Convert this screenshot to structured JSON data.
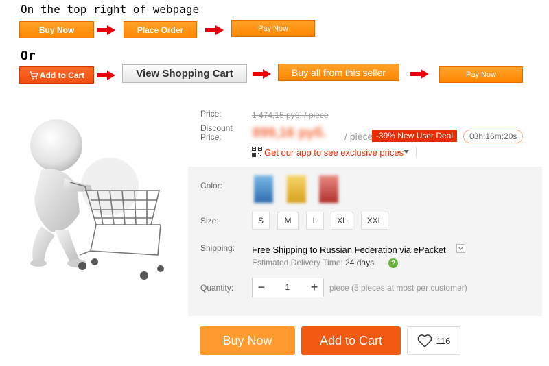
{
  "guide": {
    "caption_top": "On the top right of webpage",
    "caption_or": "Or",
    "row1": [
      "Buy Now",
      "Place Order",
      "Pay Now"
    ],
    "row2": [
      "Add to Cart",
      "View Shopping Cart",
      "Buy all from this seller",
      "Pay Now"
    ]
  },
  "product": {
    "price_label": "Price:",
    "old_price": "1 474,15 руб. / piece",
    "discount_label": "Discount Price:",
    "discount_price": "899,16 руб.",
    "per_piece": "/ piece",
    "deal_badge": "-39% New User Deal",
    "timer": "03h:16m:20s",
    "app_prompt": "Get our app to see exclusive prices",
    "color_label": "Color:",
    "size_label": "Size:",
    "sizes": [
      "S",
      "M",
      "L",
      "XL",
      "XXL"
    ],
    "shipping_label": "Shipping:",
    "shipping_free": "Free Shipping",
    "shipping_to": "to",
    "shipping_country": "Russian Federation via ePacket",
    "delivery_label": "Estimated Delivery Time:",
    "delivery_value": "24 days",
    "quantity_label": "Quantity:",
    "quantity_value": "1",
    "quantity_note": "piece (5 pieces at most per customer)",
    "buy_now": "Buy Now",
    "add_to_cart": "Add to Cart",
    "wishlist_count": "116"
  },
  "colors": {
    "accent_orange": "#ff8a1a",
    "cart_orange": "#f25a12",
    "deal_red": "#e62e04",
    "swatch_blue": "#3f86c4",
    "swatch_yellow": "#e3b325",
    "swatch_red": "#c0443c"
  },
  "icons": [
    "cart-icon",
    "qr-code-icon",
    "chevron-down-icon",
    "question-icon",
    "minus-icon",
    "plus-icon",
    "heart-icon",
    "arrow-right-icon"
  ]
}
